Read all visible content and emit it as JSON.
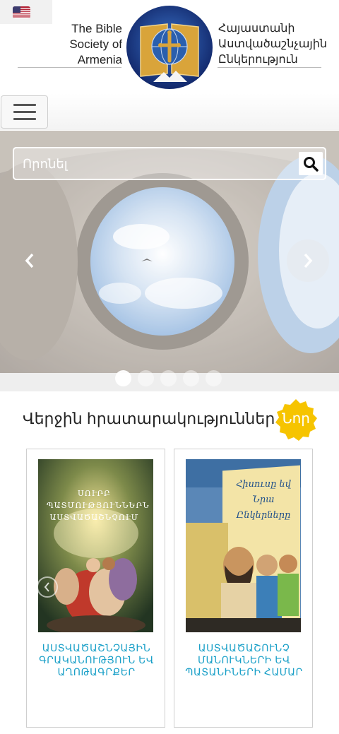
{
  "lang_flag": "us-flag-icon",
  "header": {
    "brand_en": "The Bible Society of Armenia",
    "brand_hy": "Հայաստանի Աստվածաշնչային Ընկերություն"
  },
  "nav": {
    "menu_icon": "hamburger-icon"
  },
  "search": {
    "placeholder": "Որոնել",
    "icon": "search-icon"
  },
  "slider": {
    "prev_icon": "chevron-left-icon",
    "next_icon": "chevron-right-icon",
    "slide_count": 5,
    "active_index": 0
  },
  "latest": {
    "title": "Վերջին հրատարակություններ",
    "badge": "Նոր"
  },
  "books": [
    {
      "cover_title": "ՍՈՒՐԲ ՊԱՏՄՈՒԹՅՈՒՆՆԵՐՆ ԱՍՏՎԱԾԱՇՆՉՈՒՄ",
      "title": "ԱՍՏՎԱԾԱՇՆՉԱՅԻՆ ԳՐԱԿԱՆՈՒԹՅՈՒՆ ԵՎ ԱՂՈԹԱԳՐՔԵՐ"
    },
    {
      "cover_title": "Հիսուսը եվ Նրա Ընկերները",
      "title": "ԱՍՏՎԱԾԱՇՈՒՆՉ ՄԱՆՈՒԿՆԵՐԻ ԵՎ ՊԱՏԱՆԻՆԵՐԻ ՀԱՄԱՐ"
    }
  ],
  "colors": {
    "accent": "#1aa0c8",
    "badge": "#f6c400",
    "logo_blue": "#1f3d8c",
    "logo_gold": "#d9a43a"
  }
}
